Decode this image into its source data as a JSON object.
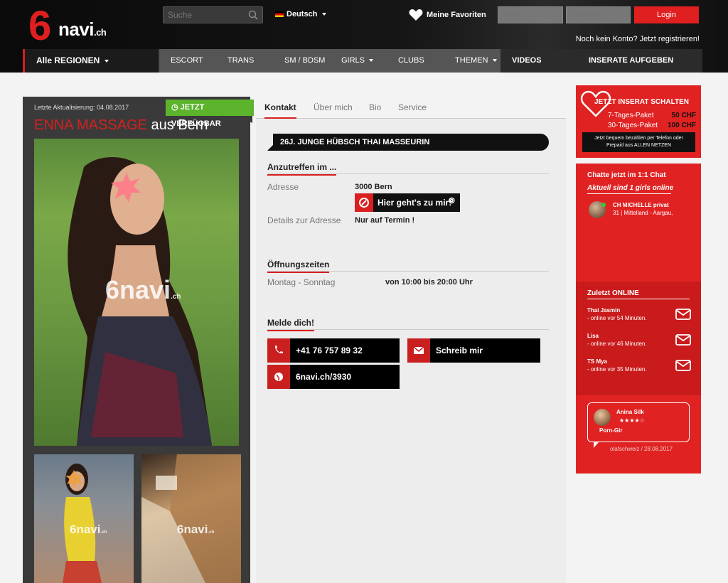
{
  "header": {
    "logo_digit": "6",
    "logo_text": "navi",
    "logo_tld": ".ch",
    "search_placeholder": "Suche",
    "language": "Deutsch",
    "favorites": "Meine Favoriten",
    "login_name_placeholder": "Name",
    "login_pass_placeholder": "Passwort",
    "login_button": "Login",
    "register_text": "Noch kein Konto? Jetzt registrieren!"
  },
  "nav": {
    "regions": "Alle REGIONEN",
    "items": [
      "ESCORT",
      "TRANS",
      "SM / BDSM",
      "GIRLS",
      "CLUBS",
      "THEMEN",
      "VIDEOS",
      "INSERATE AUFGEBEN"
    ]
  },
  "profile": {
    "last_update": "Letzte Aktualisierung: 04.08.2017",
    "availability": "JETZT VERFÜGBAR",
    "name": "ENNA MASSAGE",
    "location": "aus Bern",
    "watermark": "6navi",
    "watermark_tld": ".ch"
  },
  "tabs": [
    "Kontakt",
    "Über mich",
    "Bio",
    "Service"
  ],
  "content": {
    "headline": "26J. JUNGE HÜBSCH THAI MASSEURIN",
    "section_anzutreffen": "Anzutreffen im ...",
    "label_adresse": "Adresse",
    "value_adresse": "3000 Bern",
    "goto_button": "Hier geht's zu mir!",
    "label_details": "Details zur Adresse",
    "value_details": "Nur auf Termin !",
    "section_oeffnung": "Öffnungszeiten",
    "label_days": "Montag - Sonntag",
    "value_hours": "von 10:00 bis 20:00 Uhr",
    "section_melde": "Melde dich!",
    "phone": "+41 76 757 89 32",
    "write_me": "Schreib mir",
    "profile_link": "6navi.ch/3930"
  },
  "promo": {
    "title": "JETZT INSERAT SCHALTEN",
    "pkg1_label": "7-Tages-Paket",
    "pkg1_price": "50 CHF",
    "pkg2_label": "30-Tages-Paket",
    "pkg2_price": "100 CHF",
    "note_line1": "Jetzt bequem bezahlen per Telefon oder",
    "note_line2": "Prepaid aus ALLEN NETZEN"
  },
  "chat": {
    "title": "Chatte jetzt im 1:1 Chat",
    "subtitle": "Aktuell sind 1 girls online",
    "user_name": "CH MICHELLE privat",
    "user_info": "31 | Mittelland - Aargau,"
  },
  "online": {
    "title": "Zuletzt ONLINE",
    "items": [
      {
        "name": "Thai Jasmin",
        "time": "- online vor 54 Minuten."
      },
      {
        "name": "Lisa",
        "time": "- online vor 46 Minuten."
      },
      {
        "name": "TS Mya",
        "time": "- online vor 35 Minuten."
      }
    ]
  },
  "review": {
    "name": "Anina Silk",
    "stars": "★★★★☆",
    "text": "Porn-Gir",
    "meta": "olafschweiz /  28.08.2017"
  },
  "colors": {
    "accent": "#e02222",
    "available": "#5cb32c",
    "dark": "#111111"
  }
}
